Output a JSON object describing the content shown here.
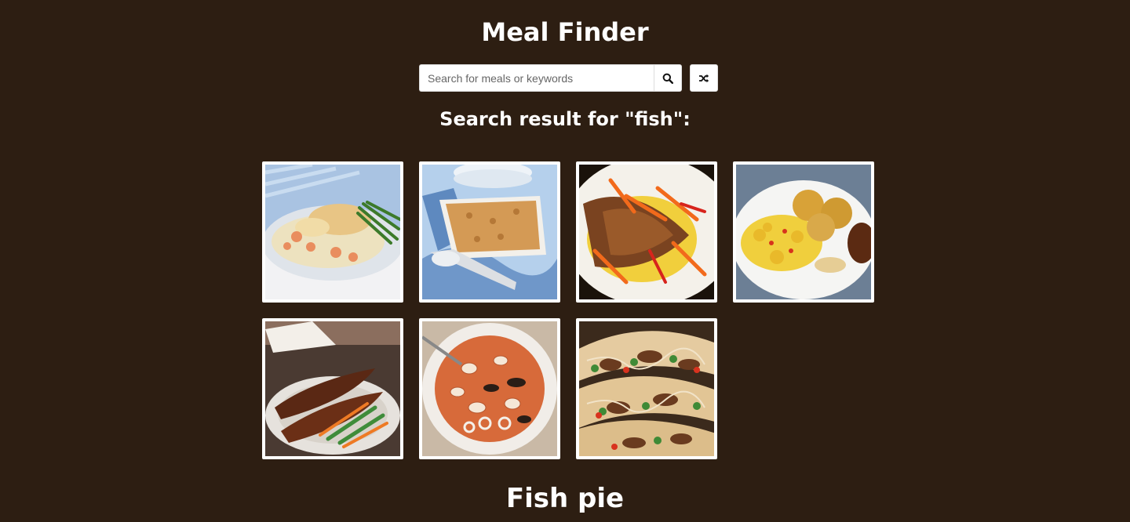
{
  "header": {
    "title": "Meal Finder"
  },
  "search": {
    "placeholder": "Search for meals or keywords",
    "value": "",
    "search_icon": "search-icon",
    "random_icon": "shuffle-icon"
  },
  "results": {
    "heading": "Search result for \"fish\":",
    "meals": [
      {
        "icon": "fish-pie-photo"
      },
      {
        "icon": "fish-bake-photo"
      },
      {
        "icon": "fried-fish-photo"
      },
      {
        "icon": "saltfish-ackee-photo"
      },
      {
        "icon": "grilled-fish-photo"
      },
      {
        "icon": "seafood-stew-photo"
      },
      {
        "icon": "fish-tacos-photo"
      }
    ]
  },
  "selected_meal": {
    "title": "Fish pie"
  },
  "colors": {
    "background": "#2d1e12",
    "text": "#ffffff"
  }
}
